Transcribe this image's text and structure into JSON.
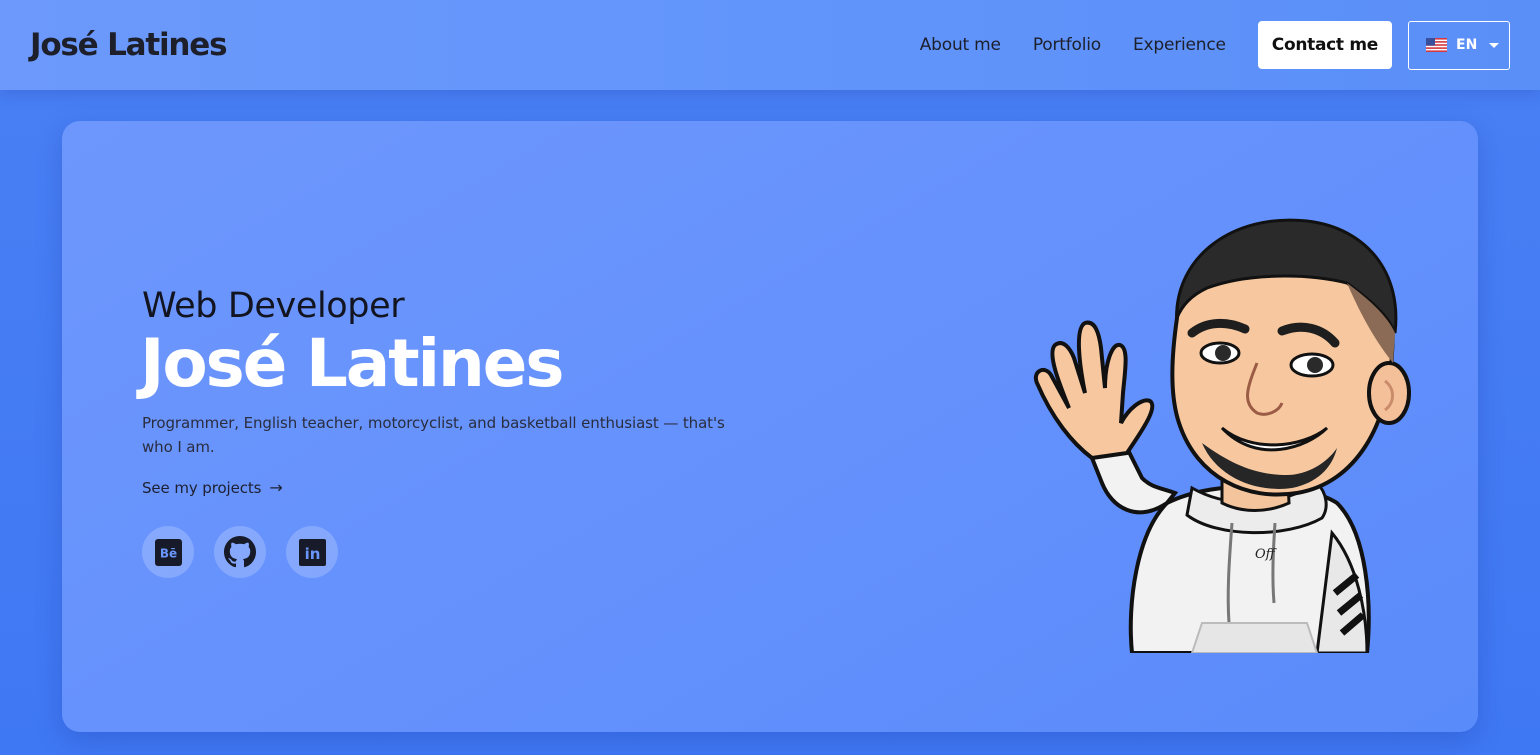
{
  "header": {
    "logo": "José Latines",
    "nav": [
      {
        "label": "About me"
      },
      {
        "label": "Portfolio"
      },
      {
        "label": "Experience"
      }
    ],
    "contact_label": "Contact me",
    "language": {
      "selected": "EN",
      "flag_icon": "us-flag-icon"
    }
  },
  "hero": {
    "subtitle": "Web Developer",
    "name": "José Latines",
    "description": "Programmer, English teacher, motorcyclist, and basketball enthusiast — that's who I am.",
    "projects_link": "See my projects",
    "projects_arrow": "→",
    "socials": [
      {
        "icon": "behance-icon",
        "glyph": "Bē"
      },
      {
        "icon": "github-icon"
      },
      {
        "icon": "linkedin-icon",
        "glyph": "in"
      }
    ],
    "avatar": {
      "icon": "waving-avatar-illustration",
      "hoodie_text": "Off"
    }
  },
  "colors": {
    "page_bg": "#4a80f5",
    "header_bg": "#6c99fb",
    "card_bg": "#6692fd",
    "name_color": "#ffffff",
    "text_dark": "#1d1f2b"
  }
}
